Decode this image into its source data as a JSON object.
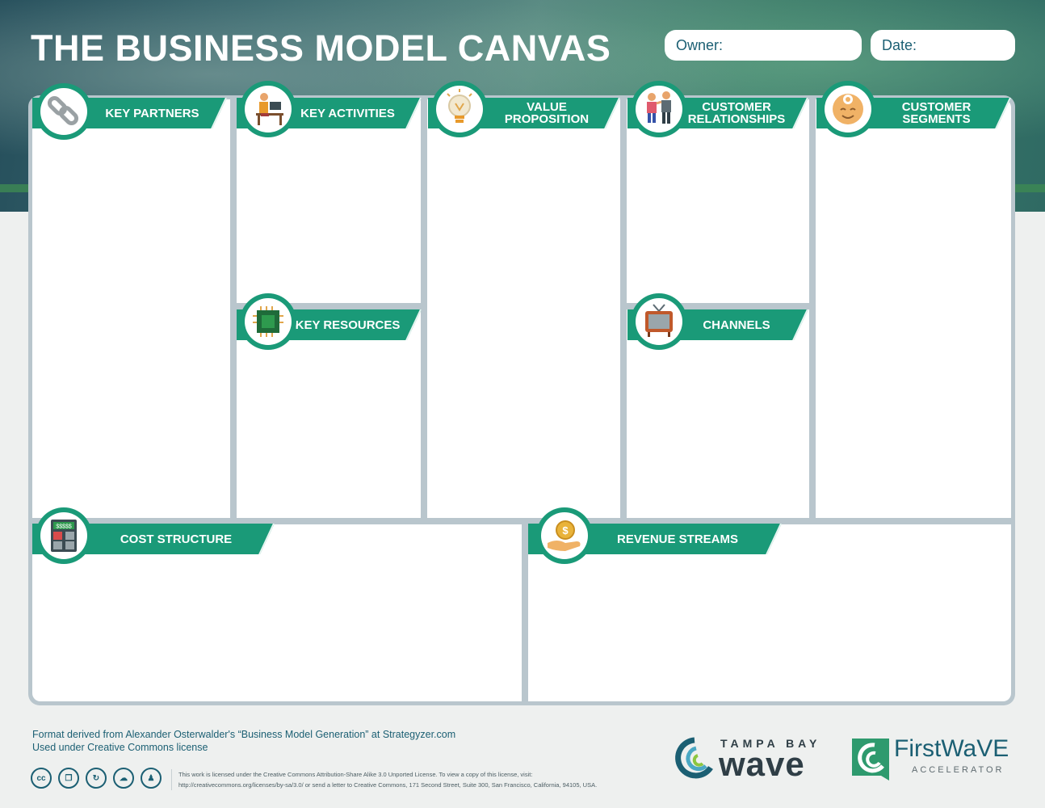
{
  "header": {
    "title": "THE BUSINESS MODEL CANVAS",
    "owner_label": "Owner:",
    "date_label": "Date:"
  },
  "sections": {
    "key_partners": "KEY PARTNERS",
    "key_activities": "KEY ACTIVITIES",
    "key_resources": "KEY RESOURCES",
    "value_proposition": "VALUE PROPOSITION",
    "customer_relationships": "CUSTOMER RELATIONSHIPS",
    "channels": "CHANNELS",
    "customer_segments": "CUSTOMER SEGMENTS",
    "cost_structure": "COST STRUCTURE",
    "revenue_streams": "REVENUE STREAMS"
  },
  "icons": {
    "key_partners": "chain-link-icon",
    "key_activities": "person-at-desk-icon",
    "key_resources": "microchip-icon",
    "value_proposition": "light-bulb-icon",
    "customer_relationships": "two-people-icon",
    "channels": "television-icon",
    "customer_segments": "smiling-face-icon",
    "cost_structure": "calculator-icon",
    "revenue_streams": "coin-in-hand-icon"
  },
  "calculator_screen": "$$$$$",
  "footer": {
    "credit_line1": "Format derived from Alexander Osterwalder's “Business Model Generation” at Strategyzer.com",
    "credit_line2": "Used under Creative Commons license",
    "license_line1": "This work is licensed under the Creative Commons Attribution-Share Alike 3.0 Unported License. To view a copy of this license, visit:",
    "license_line2": "http://creativecommons.org/licenses/by-sa/3.0/ or send a letter to Creative Commons, 171 Second Street, Suite 300, San Francisco, California, 94105, USA.",
    "cc_icons": [
      "cc",
      "copy",
      "refresh",
      "share",
      "attribution"
    ]
  },
  "logos": {
    "tampa_top": "TAMPA BAY",
    "tampa_main": "wave",
    "firstwave_main": "FirstWaVE",
    "firstwave_sub": "ACCELERATOR"
  },
  "colors": {
    "accent_green": "#1a9a78",
    "frame_gray": "#b9c6cd",
    "text_teal": "#1b5f73"
  }
}
